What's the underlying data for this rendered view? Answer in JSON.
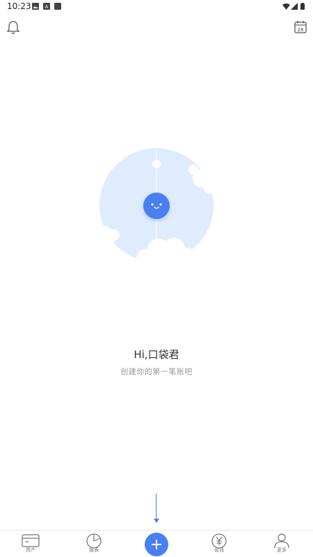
{
  "status_bar": {
    "time": "10:23",
    "icons_left": [
      "image-icon",
      "a-icon",
      "square-icon"
    ],
    "icons_right": [
      "wifi-icon",
      "signal-icon",
      "battery-icon"
    ]
  },
  "top_bar": {
    "left_icon": "bell-icon",
    "right_icon": "calendar-icon",
    "calendar_day": "28"
  },
  "empty_state": {
    "title": "Hi,口袋君",
    "subtitle": "创建你的第一笔账吧",
    "illustration": "moon-face-with-clouds"
  },
  "tabs": [
    {
      "label": "资产",
      "icon": "card-icon"
    },
    {
      "label": "报表",
      "icon": "pie-chart-icon"
    },
    {
      "label": "",
      "icon": "add-icon"
    },
    {
      "label": "省钱",
      "icon": "yen-icon"
    },
    {
      "label": "更多",
      "icon": "user-icon"
    }
  ],
  "colors": {
    "accent": "#4a7ff0",
    "illustration_bg": "#dfecfd",
    "text_primary": "#333333",
    "text_secondary": "#9a9a9a"
  }
}
